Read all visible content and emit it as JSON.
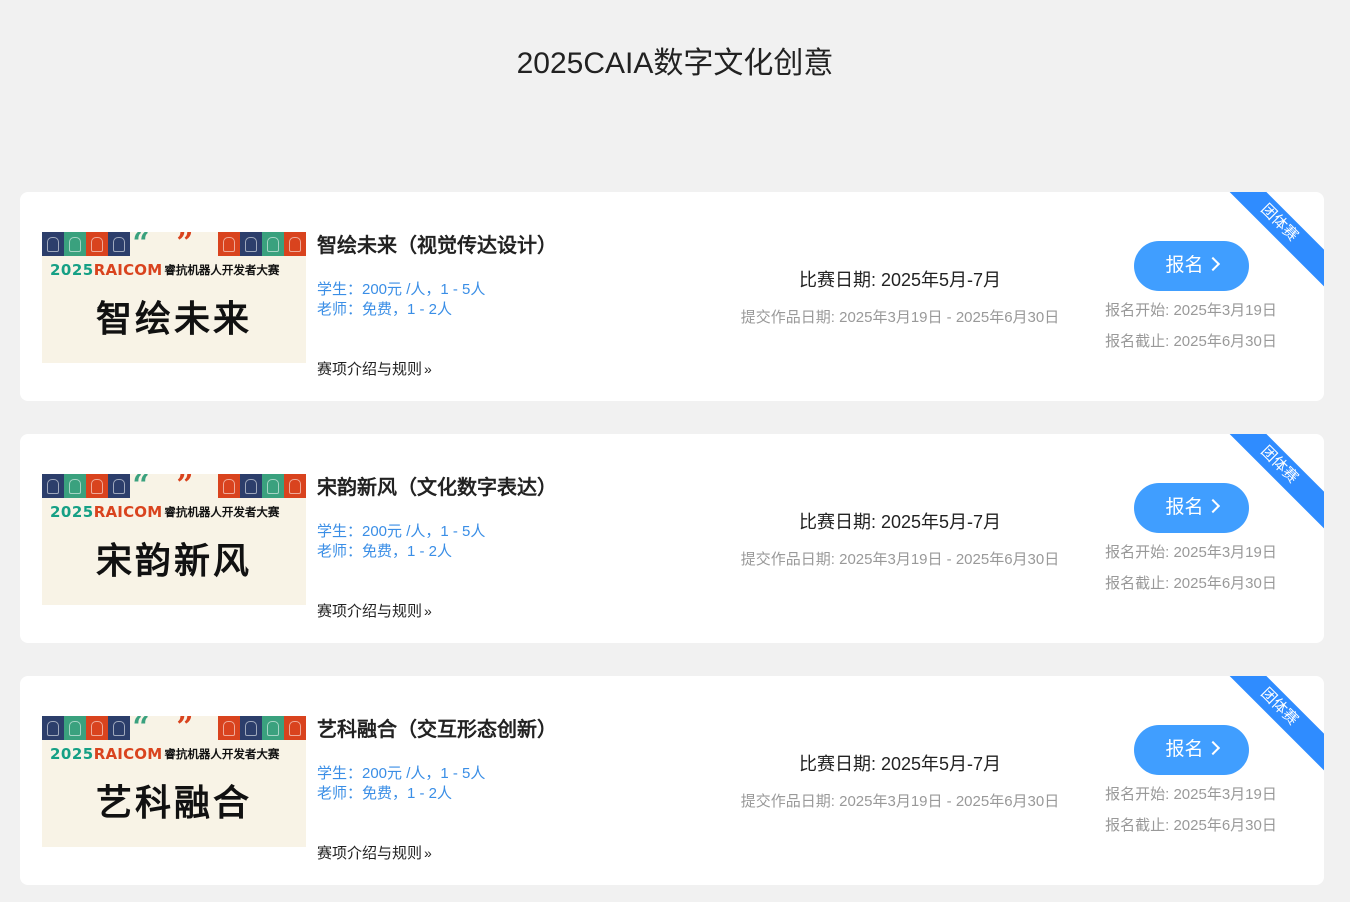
{
  "page": {
    "title": "2025CAIA数字文化创意"
  },
  "banner_common": {
    "year": "2025",
    "brand": "RAICOM",
    "subtitle": "睿抗机器人开发者大赛",
    "open_quote": "“",
    "close_quote": "”"
  },
  "colors": {
    "accent": "#409eff",
    "ribbon": "#2f8cff",
    "fee_text": "#3a8ee6",
    "muted": "#999999",
    "banner_bg": "#f8f3e6"
  },
  "competitions": [
    {
      "ribbon": "团体赛",
      "banner_title": "智绘未来",
      "name": "智绘未来（视觉传达设计）",
      "fee_student": "学生：200元 /人，1 - 5人",
      "fee_teacher": "老师：免费，1 - 2人",
      "rules_link": "赛项介绍与规则",
      "match_date": "比赛日期: 2025年5月-7月",
      "submit_date": "提交作品日期: 2025年3月19日 - 2025年6月30日",
      "signup_label": "报名",
      "reg_open": "报名开始: 2025年3月19日",
      "reg_close": "报名截止: 2025年6月30日"
    },
    {
      "ribbon": "团体赛",
      "banner_title": "宋韵新风",
      "name": "宋韵新风（文化数字表达）",
      "fee_student": "学生：200元 /人，1 - 5人",
      "fee_teacher": "老师：免费，1 - 2人",
      "rules_link": "赛项介绍与规则",
      "match_date": "比赛日期: 2025年5月-7月",
      "submit_date": "提交作品日期: 2025年3月19日 - 2025年6月30日",
      "signup_label": "报名",
      "reg_open": "报名开始: 2025年3月19日",
      "reg_close": "报名截止: 2025年6月30日"
    },
    {
      "ribbon": "团体赛",
      "banner_title": "艺科融合",
      "name": "艺科融合（交互形态创新）",
      "fee_student": "学生：200元 /人，1 - 5人",
      "fee_teacher": "老师：免费，1 - 2人",
      "rules_link": "赛项介绍与规则",
      "match_date": "比赛日期: 2025年5月-7月",
      "submit_date": "提交作品日期: 2025年3月19日 - 2025年6月30日",
      "signup_label": "报名",
      "reg_open": "报名开始: 2025年3月19日",
      "reg_close": "报名截止: 2025年6月30日"
    }
  ]
}
